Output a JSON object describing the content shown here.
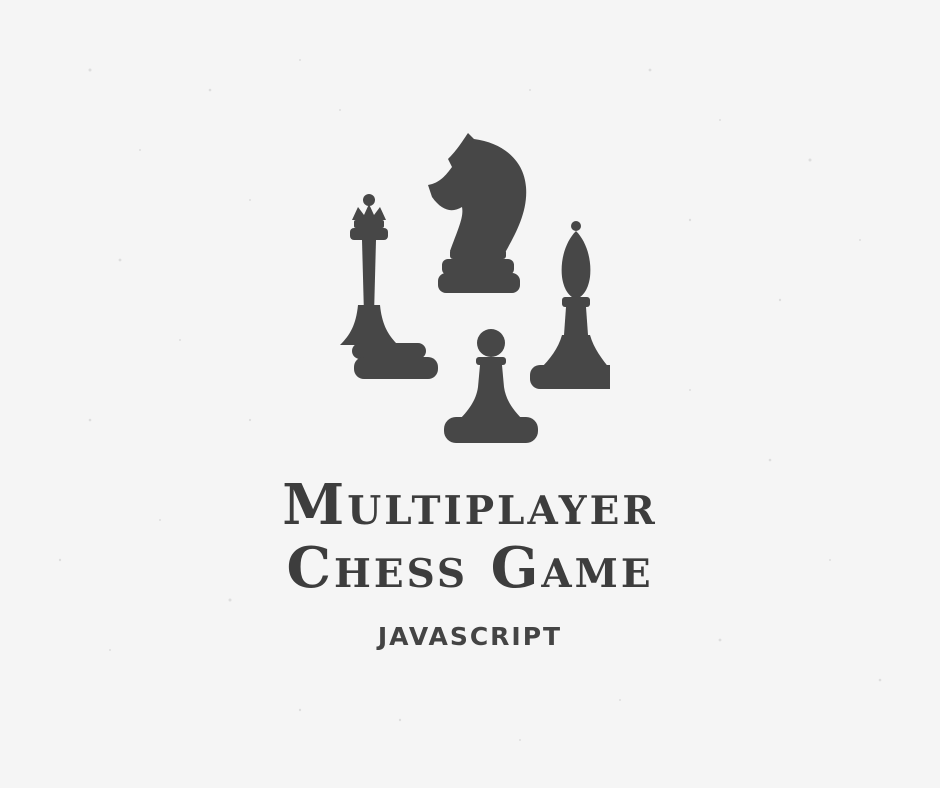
{
  "poster": {
    "title_line_1": "Multiplayer",
    "title_line_2": "Chess Game",
    "subtitle": "JAVASCRIPT"
  },
  "icons": [
    "queen-icon",
    "knight-icon",
    "bishop-icon",
    "pawn-icon"
  ],
  "colors": {
    "background": "#f5f5f5",
    "piece_fill": "#474747",
    "text": "#3d3d3d"
  }
}
